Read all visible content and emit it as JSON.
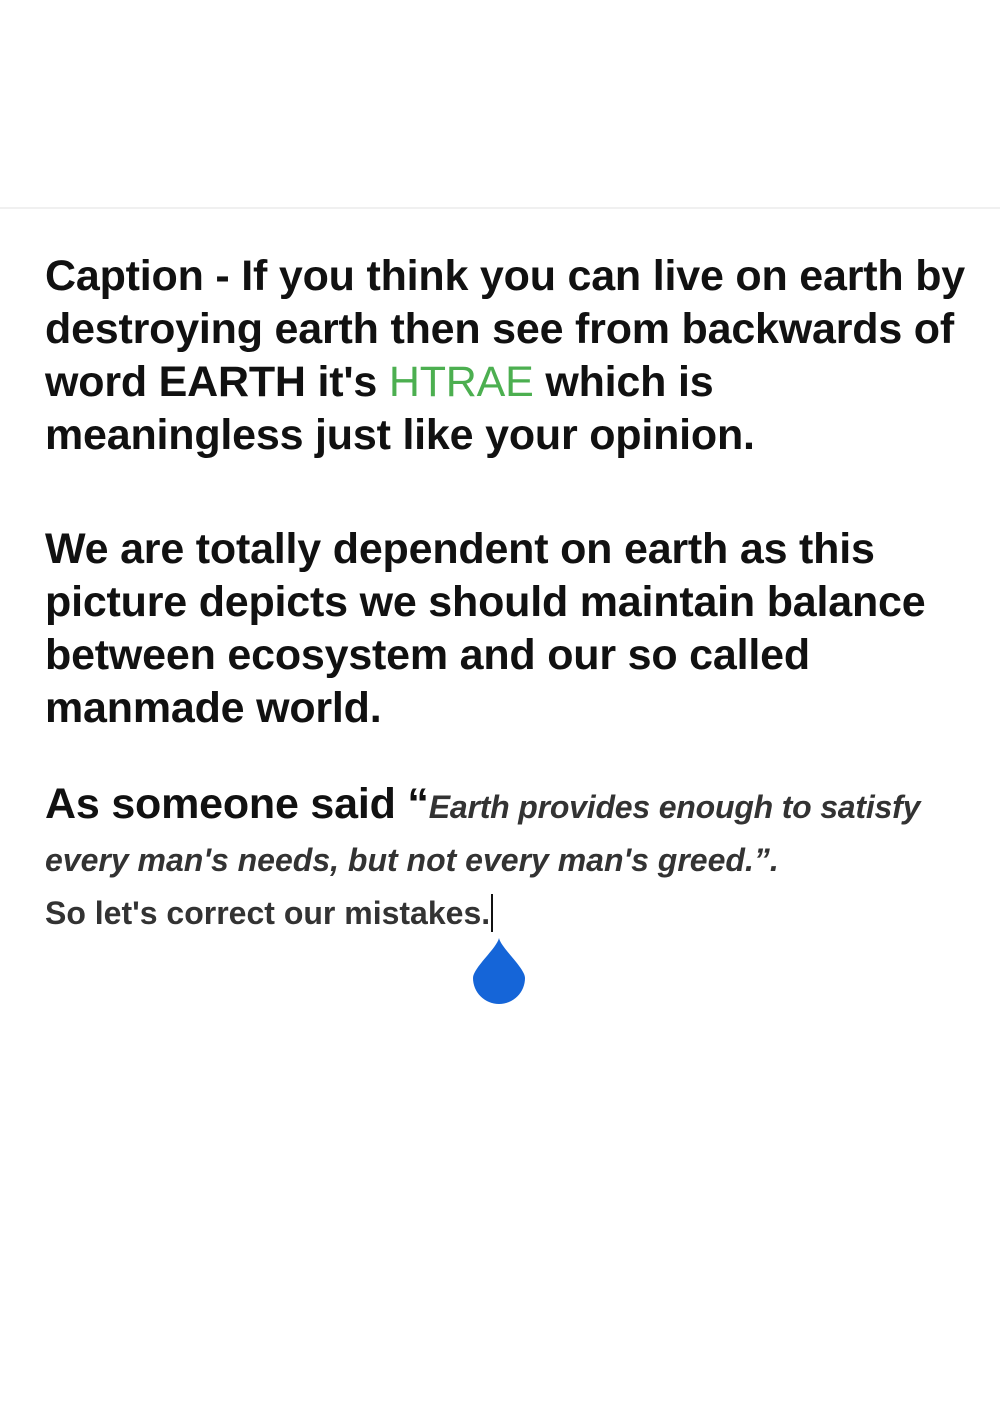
{
  "editor": {
    "paragraph1": {
      "before": "Caption - If you think you can live on earth by destroying earth then see from backwards of word EARTH it's ",
      "highlight": "HTRAE",
      "after": " which is meaningless just like your opinion."
    },
    "paragraph2": "We are totally dependent on earth as this picture depicts we should maintain balance between ecosystem and our so called manmade world.",
    "quote_intro": "As someone said “",
    "quote_part1": "Earth provides enough to satisfy",
    "quote_part2": "every man's needs, but not every man's greed.”.",
    "closing": "So let's correct our mistakes."
  },
  "colors": {
    "highlight": "#4caf50",
    "cursor_handle": "#1565d8"
  },
  "icons": {
    "cursor_handle": "text-cursor-handle-icon"
  }
}
